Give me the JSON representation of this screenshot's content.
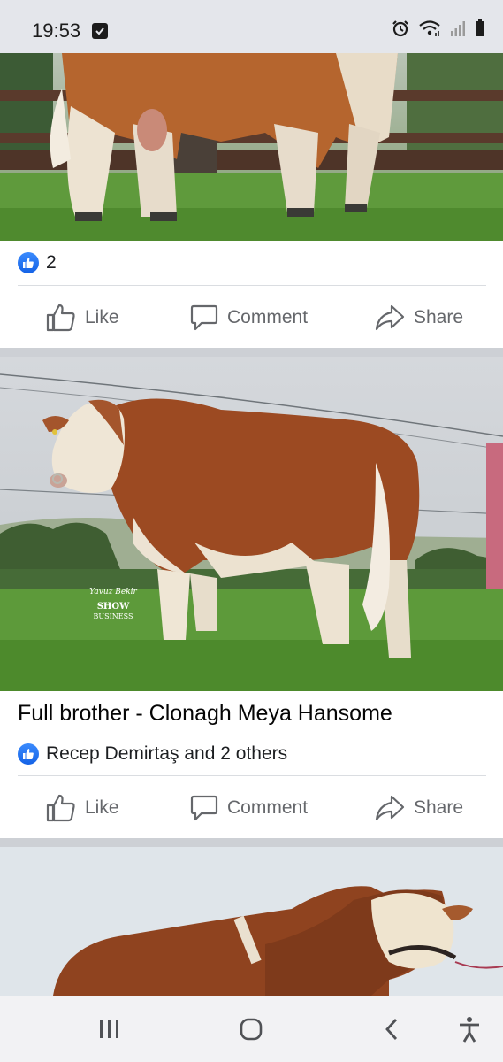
{
  "status_bar": {
    "time": "19:53",
    "icons": [
      "checkbox-notification-icon",
      "alarm-icon",
      "wifi-icon",
      "signal-icon",
      "battery-icon"
    ]
  },
  "posts": [
    {
      "photo": "Simmental bull standing in field near wooden fence (cropped top)",
      "reaction_count": "2",
      "actions": {
        "like": "Like",
        "comment": "Comment",
        "share": "Share"
      }
    },
    {
      "photo_watermark": "SHOW BUSINESS",
      "caption": "Full brother - Clonagh Meya Hansome",
      "reaction_text": "Recep Demirtaş and 2 others",
      "actions": {
        "like": "Like",
        "comment": "Comment",
        "share": "Share"
      }
    }
  ],
  "colors": {
    "accent": "#1877f2",
    "action_gray": "#65676b",
    "divider": "#cdd0d5"
  },
  "nav_bar": {
    "icons": [
      "recent-apps-icon",
      "home-icon",
      "back-icon",
      "accessibility-icon"
    ]
  }
}
